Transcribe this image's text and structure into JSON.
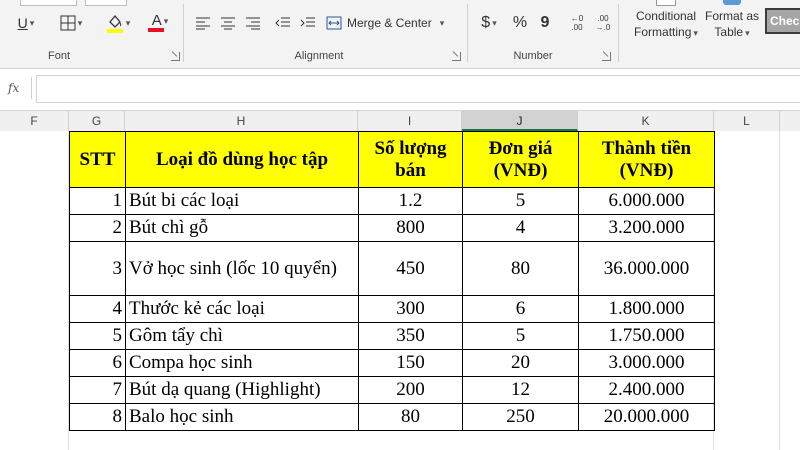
{
  "ribbon": {
    "font": {
      "label": "Font",
      "underline": "U",
      "font_color_letter": "A",
      "font_color": "#e81123",
      "fill_color": "#ffff00"
    },
    "alignment": {
      "label": "Alignment",
      "merge_center": "Merge & Center"
    },
    "number": {
      "label": "Number",
      "currency_symbol": "$",
      "percent": "%",
      "comma": "9",
      "inc_decimal_top": "←0",
      "inc_decimal_bottom": ".00",
      "dec_decimal_top": ".00",
      "dec_decimal_bottom": "→.0"
    },
    "styles": {
      "conditional_line1": "Conditional",
      "conditional_line2": "Formatting",
      "format_table_line1": "Format as",
      "format_table_line2": "Table",
      "cell_style": "Chec"
    }
  },
  "formula_bar": {
    "fx": "fx",
    "value": ""
  },
  "columns": [
    "F",
    "G",
    "H",
    "I",
    "J",
    "K",
    "L"
  ],
  "table": {
    "header": [
      "STT",
      "Loại đồ dùng học tập",
      "Số lượng bán",
      "Đơn giá (VNĐ)",
      "Thành tiền (VNĐ)"
    ],
    "rows": [
      {
        "stt": "1",
        "name": "Bút bi các loại",
        "qty": "1.2",
        "price": "5",
        "total": "6.000.000"
      },
      {
        "stt": "2",
        "name": "Bút chì gỗ",
        "qty": "800",
        "price": "4",
        "total": "3.200.000"
      },
      {
        "stt": "3",
        "name": "Vở học sinh (lốc 10 quyển)",
        "qty": "450",
        "price": "80",
        "total": "36.000.000"
      },
      {
        "stt": "4",
        "name": "Thước kẻ các loại",
        "qty": "300",
        "price": "6",
        "total": "1.800.000"
      },
      {
        "stt": "5",
        "name": "Gôm tẩy chì",
        "qty": "350",
        "price": "5",
        "total": "1.750.000"
      },
      {
        "stt": "6",
        "name": "Compa học sinh",
        "qty": "150",
        "price": "20",
        "total": "3.000.000"
      },
      {
        "stt": "7",
        "name": "Bút dạ quang (Highlight)",
        "qty": "200",
        "price": "12",
        "total": "2.400.000"
      },
      {
        "stt": "8",
        "name": "Balo học sinh",
        "qty": "80",
        "price": "250",
        "total": "20.000.000"
      }
    ]
  }
}
